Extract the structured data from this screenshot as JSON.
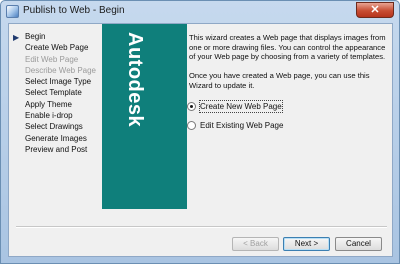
{
  "window": {
    "title": "Publish to Web - Begin",
    "close_glyph": "✕"
  },
  "steps": [
    {
      "label": "Begin",
      "enabled": true,
      "current": true
    },
    {
      "label": "Create Web Page",
      "enabled": true
    },
    {
      "label": "Edit Web Page",
      "enabled": false
    },
    {
      "label": "Describe Web Page",
      "enabled": false
    },
    {
      "label": "Select Image Type",
      "enabled": true
    },
    {
      "label": "Select Template",
      "enabled": true
    },
    {
      "label": "Apply Theme",
      "enabled": true
    },
    {
      "label": "Enable i-drop",
      "enabled": true
    },
    {
      "label": "Select Drawings",
      "enabled": true
    },
    {
      "label": "Generate Images",
      "enabled": true
    },
    {
      "label": "Preview and Post",
      "enabled": true
    }
  ],
  "banner": {
    "text": "Autodesk",
    "color": "#0f7f7b"
  },
  "content": {
    "description1": "This wizard creates a Web page that displays images from one or more drawing files.  You can control the appearance of your Web page by choosing from a variety of templates.",
    "description2": "Once you have created a Web page, you can use this Wizard to update it.",
    "options": [
      {
        "label": "Create New Web Page",
        "checked": true
      },
      {
        "label": "Edit Existing Web Page",
        "checked": false
      }
    ]
  },
  "buttons": {
    "back": "< Back",
    "next": "Next >",
    "cancel": "Cancel"
  }
}
